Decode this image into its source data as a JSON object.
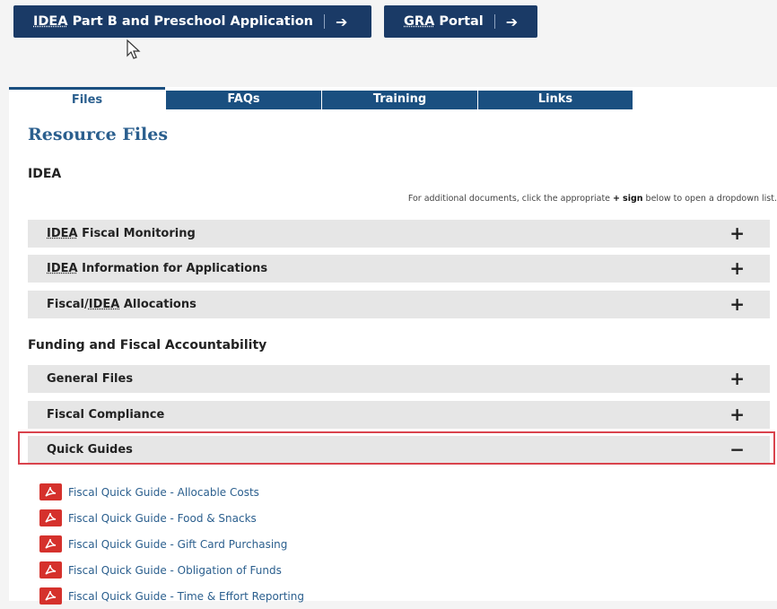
{
  "top_buttons": {
    "idea": {
      "label": "IDEA Part B and Preschool Application",
      "abbr": "IDEA",
      "rest": " Part B and Preschool Application",
      "arrow": "➔"
    },
    "gra": {
      "label": "GRA Portal",
      "abbr": "GRA",
      "rest": " Portal",
      "arrow": "➔"
    }
  },
  "tabs": [
    {
      "label": "Files",
      "active": true
    },
    {
      "label": "FAQs",
      "active": false
    },
    {
      "label": "Training",
      "active": false
    },
    {
      "label": "Links",
      "active": false
    }
  ],
  "page_title": "Resource Files",
  "sections": [
    {
      "heading": "IDEA",
      "note": {
        "prefix": "For additional documents, click the appropriate ",
        "plus": "+",
        "sign": "sign",
        "suffix": " below to open a dropdown list."
      },
      "items": [
        {
          "label": "IDEA Fiscal Monitoring",
          "toggle": "+"
        },
        {
          "label": "IDEA Information for Applications",
          "toggle": "+"
        },
        {
          "label": "Fiscal/IDEA Allocations",
          "toggle": "+"
        }
      ]
    },
    {
      "heading": "Funding and Fiscal Accountability",
      "items": [
        {
          "label": "General Files",
          "toggle": "+"
        },
        {
          "label": "Fiscal Compliance",
          "toggle": "+"
        },
        {
          "label": "Quick Guides",
          "toggle": "−",
          "expanded": true
        }
      ]
    }
  ],
  "quick_guides_files": [
    "Fiscal Quick Guide - Allocable Costs",
    "Fiscal Quick Guide - Food & Snacks",
    "Fiscal Quick Guide - Gift Card Purchasing",
    "Fiscal Quick Guide - Obligation of Funds",
    "Fiscal Quick Guide - Time & Effort Reporting"
  ],
  "colors": {
    "nav_blue": "#1a4f80",
    "dark_blue": "#1a3a66",
    "link_blue": "#2b5f8e",
    "highlight_red": "#d9434d",
    "pdf_red": "#d5312c"
  }
}
